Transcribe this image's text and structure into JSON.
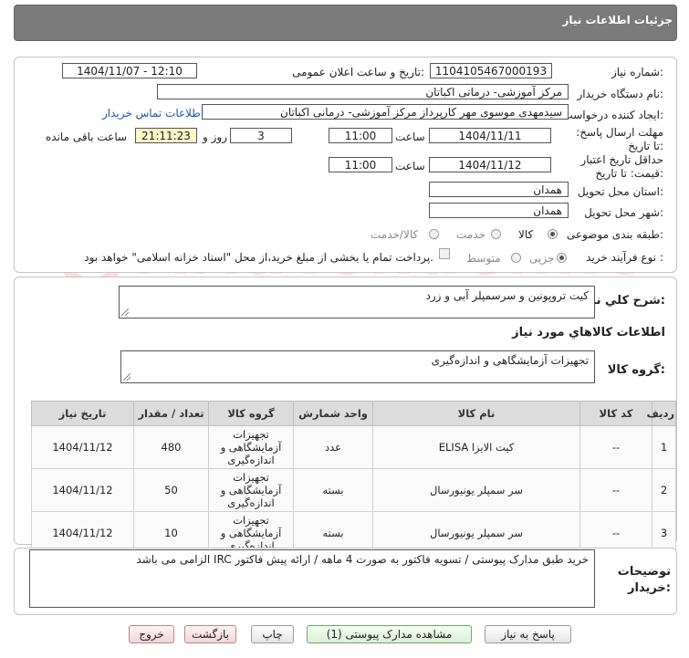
{
  "header": {
    "title": "جزئیات اطلاعات نیاز"
  },
  "info": {
    "need_number_label": "شماره نیاز:",
    "need_number": "1104105467000193",
    "announce_label": "تاریخ و ساعت اعلان عمومی:",
    "announce_value": "1404/11/07 - 12:10",
    "buyer_org_label": "نام دستگاه خریدار:",
    "buyer_org": "مرکز آموزشی- درمانی اکباتان",
    "requester_label": "ایجاد کننده درخواست:",
    "requester": "سیدمهدی موسوی مهر کارپرداز مرکز آموزشی- درمانی اکباتان",
    "contact_link": "اطلاعات تماس خریدار",
    "reply_deadline_label": "مهلت ارسال پاسخ: تا تاریخ:",
    "reply_date": "1404/11/11",
    "time_label": "ساعت",
    "reply_time": "11:00",
    "days_value": "3",
    "days_label": "روز و",
    "remaining_time": "21:11:23",
    "remaining_label": "ساعت باقی مانده",
    "validity_label": "حداقل تاریخ اعتبار قیمت: تا تاریخ:",
    "validity_date": "1404/11/12",
    "validity_time": "11:00",
    "province_label": "استان محل تحویل:",
    "province": "همدان",
    "city_label": "شهر محل تحویل:",
    "city": "همدان",
    "category_label": "طبقه بندی موضوعی:",
    "category_options": [
      "کالا",
      "خدمت",
      "کالا/خدمت"
    ],
    "process_label": "نوع فرآیند خرید :",
    "process_options": [
      "جزیی",
      "متوسط"
    ],
    "payment_note": "پرداخت تمام یا بخشی از مبلغ خرید،از محل \"اسناد خزانه اسلامی\" خواهد بود."
  },
  "summary": {
    "label": "شرح کلي نیاز:",
    "value": "کیت تروپونین و سرسمپلر آبی و زرد"
  },
  "goods_info": {
    "title": "اطلاعات کالاهاي مورد نیاز",
    "group_label": "گروه کالا:",
    "group_value": "تجهیزات آزمایشگاهی و اندازه‌گیری"
  },
  "table": {
    "headers": [
      "ردیف",
      "کد کالا",
      "نام کالا",
      "واحد شمارش",
      "گروه کالا",
      "تعداد / مقدار",
      "تاریخ نیاز"
    ],
    "rows": [
      [
        "1",
        "--",
        "کیت الایزا ELISA",
        "عدد",
        "تجهیزات آزمایشگاهی و اندازه‌گیری",
        "480",
        "1404/11/12"
      ],
      [
        "2",
        "--",
        "سر سمپلر یونیورسال",
        "بسته",
        "تجهیزات آزمایشگاهی و اندازه‌گیری",
        "50",
        "1404/11/12"
      ],
      [
        "3",
        "--",
        "سر سمپلر یونیورسال",
        "بسته",
        "تجهیزات آزمایشگاهی و اندازه‌گیری",
        "10",
        "1404/11/12"
      ]
    ]
  },
  "notes": {
    "label": "توضیحات خریدار:",
    "value": "خرید طبق مدارک پیوستی / تسویه فاکتور به صورت 4 ماهه / ارائه پیش فاکتور IRC الزامی می باشد"
  },
  "buttons": {
    "reply": "پاسخ به نیاز",
    "attachments": "مشاهده مدارک پیوستی (1)",
    "print": "چاپ",
    "back": "بازگشت",
    "exit": "خروج"
  },
  "watermark": {
    "text": "AriaTender.neT"
  }
}
